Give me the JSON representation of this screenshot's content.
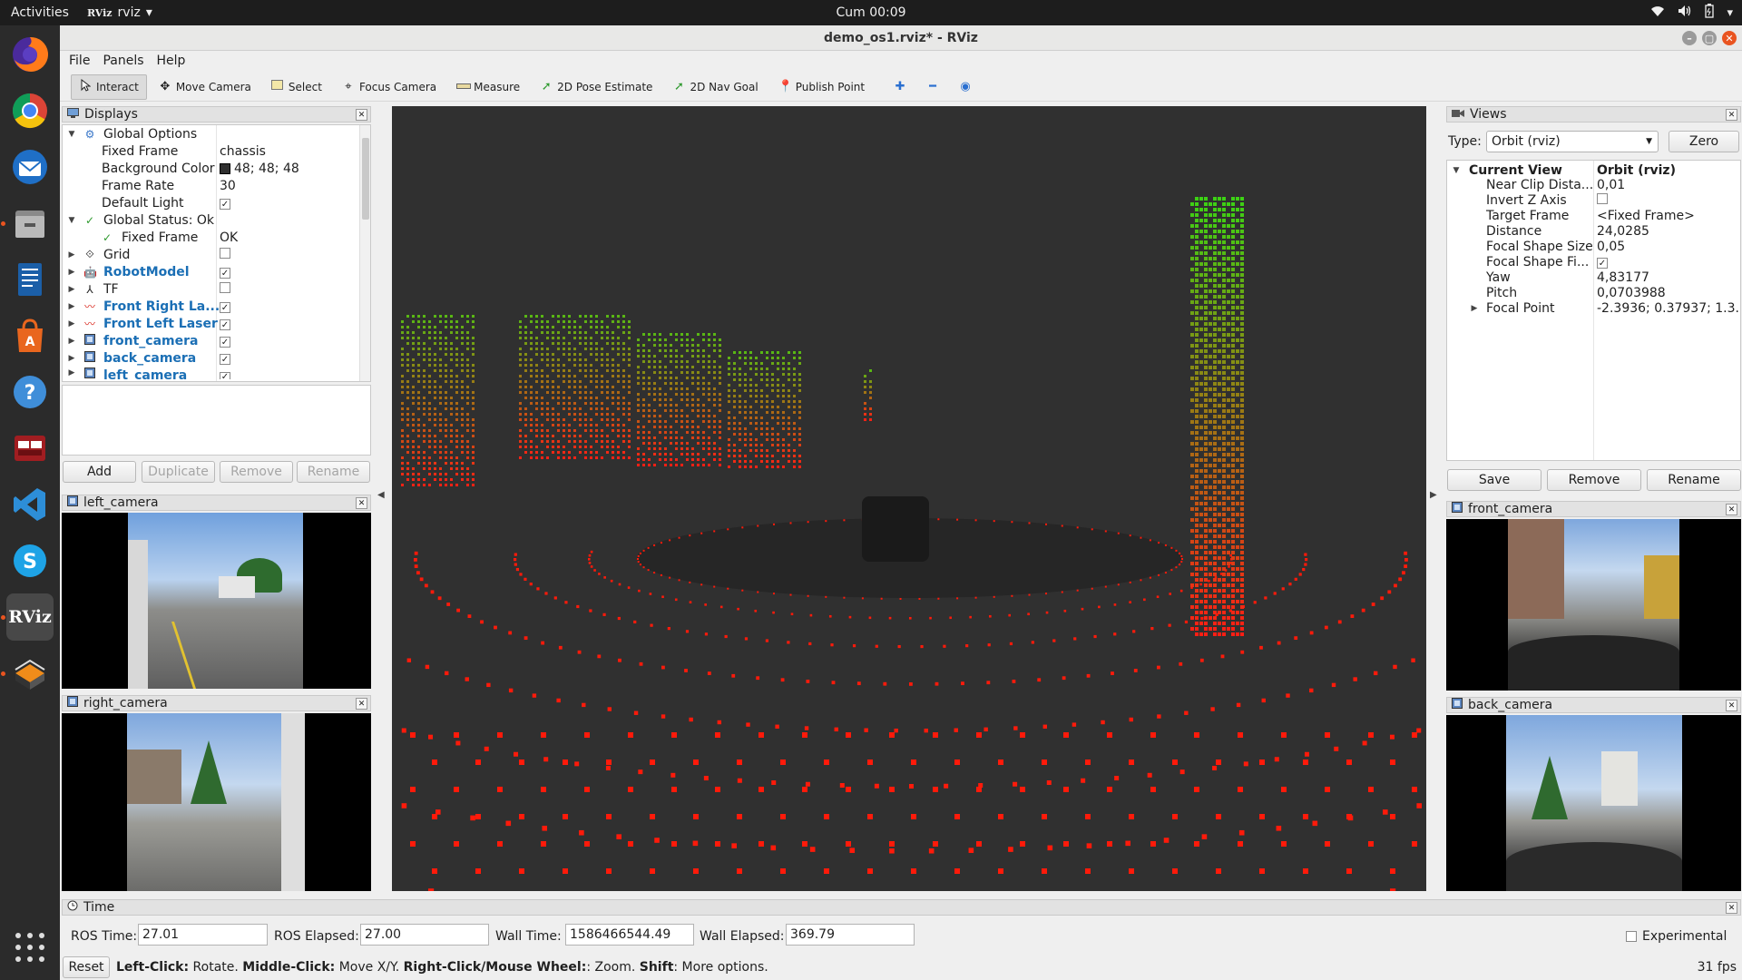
{
  "topbar": {
    "activities": "Activities",
    "app_name": "rviz",
    "app_logo_text": "RViz",
    "clock": "Cum 00:09"
  },
  "dock": {
    "apps": [
      "firefox-icon",
      "chrome-icon",
      "thunderbird-icon",
      "files-icon",
      "writer-icon",
      "software-icon",
      "help-icon",
      "terminal-icon",
      "vscode-icon",
      "skype-icon",
      "rviz-icon",
      "gazebo-icon"
    ],
    "rviz_label": "RViz"
  },
  "window": {
    "title": "demo_os1.rviz* - RViz"
  },
  "menu": {
    "file": "File",
    "panels": "Panels",
    "help": "Help"
  },
  "toolbar": {
    "interact": "Interact",
    "move_camera": "Move Camera",
    "select": "Select",
    "focus_camera": "Focus Camera",
    "measure": "Measure",
    "pose_estimate": "2D Pose Estimate",
    "nav_goal": "2D Nav Goal",
    "publish_point": "Publish Point"
  },
  "displays": {
    "title": "Displays",
    "global_options": "Global Options",
    "fixed_frame_label": "Fixed Frame",
    "fixed_frame_value": "chassis",
    "bg_color_label": "Background Color",
    "bg_color_value": "48; 48; 48",
    "frame_rate_label": "Frame Rate",
    "frame_rate_value": "30",
    "default_light_label": "Default Light",
    "global_status": "Global Status: Ok",
    "status_fixed_frame_label": "Fixed Frame",
    "status_fixed_frame_value": "OK",
    "items": [
      {
        "label": "Grid",
        "checked": false,
        "style": "plain"
      },
      {
        "label": "RobotModel",
        "checked": true,
        "style": "blue"
      },
      {
        "label": "TF",
        "checked": false,
        "style": "plain"
      },
      {
        "label": "Front Right La...",
        "checked": true,
        "style": "blue"
      },
      {
        "label": "Front Left Laser",
        "checked": true,
        "style": "blue"
      },
      {
        "label": "front_camera",
        "checked": true,
        "style": "blue"
      },
      {
        "label": "back_camera",
        "checked": true,
        "style": "blue"
      },
      {
        "label": "left_camera",
        "checked": true,
        "style": "blue"
      }
    ],
    "buttons": {
      "add": "Add",
      "duplicate": "Duplicate",
      "remove": "Remove",
      "rename": "Rename"
    }
  },
  "cameras": {
    "left": "left_camera",
    "right": "right_camera",
    "front": "front_camera",
    "back": "back_camera"
  },
  "views": {
    "title": "Views",
    "type_label": "Type:",
    "type_value": "Orbit (rviz)",
    "zero": "Zero",
    "current_view": "Current View",
    "current_view_value": "Orbit (rviz)",
    "props": [
      {
        "label": "Near Clip Dista...",
        "value": "0,01"
      },
      {
        "label": "Invert Z Axis",
        "value": ""
      },
      {
        "label": "Target Frame",
        "value": "<Fixed Frame>"
      },
      {
        "label": "Distance",
        "value": "24,0285"
      },
      {
        "label": "Focal Shape Size",
        "value": "0,05"
      },
      {
        "label": "Focal Shape Fi...",
        "value": ""
      },
      {
        "label": "Yaw",
        "value": "4,83177"
      },
      {
        "label": "Pitch",
        "value": "0,0703988"
      },
      {
        "label": "Focal Point",
        "value": "-2.3936; 0.37937; 1.3..."
      }
    ],
    "buttons": {
      "save": "Save",
      "remove": "Remove",
      "rename": "Rename"
    }
  },
  "time": {
    "title": "Time",
    "ros_time_label": "ROS Time:",
    "ros_time": "27.01",
    "ros_elapsed_label": "ROS Elapsed:",
    "ros_elapsed": "27.00",
    "wall_time_label": "Wall Time:",
    "wall_time": "1586466544.49",
    "wall_elapsed_label": "Wall Elapsed:",
    "wall_elapsed": "369.79",
    "experimental": "Experimental",
    "reset": "Reset",
    "hint_1_key": "Left-Click:",
    "hint_1_val": " Rotate. ",
    "hint_2_key": "Middle-Click:",
    "hint_2_val": " Move X/Y. ",
    "hint_3_key": "Right-Click/Mouse Wheel:",
    "hint_3_val": ": Zoom. ",
    "hint_4_key": "Shift",
    "hint_4_val": ": More options.",
    "fps": "31 fps"
  },
  "colors": {
    "background": "#303030",
    "accent": "#e95420",
    "link_blue": "#1b6fb5",
    "point_red": "#ff1a0a",
    "point_green": "#3cd21e"
  }
}
